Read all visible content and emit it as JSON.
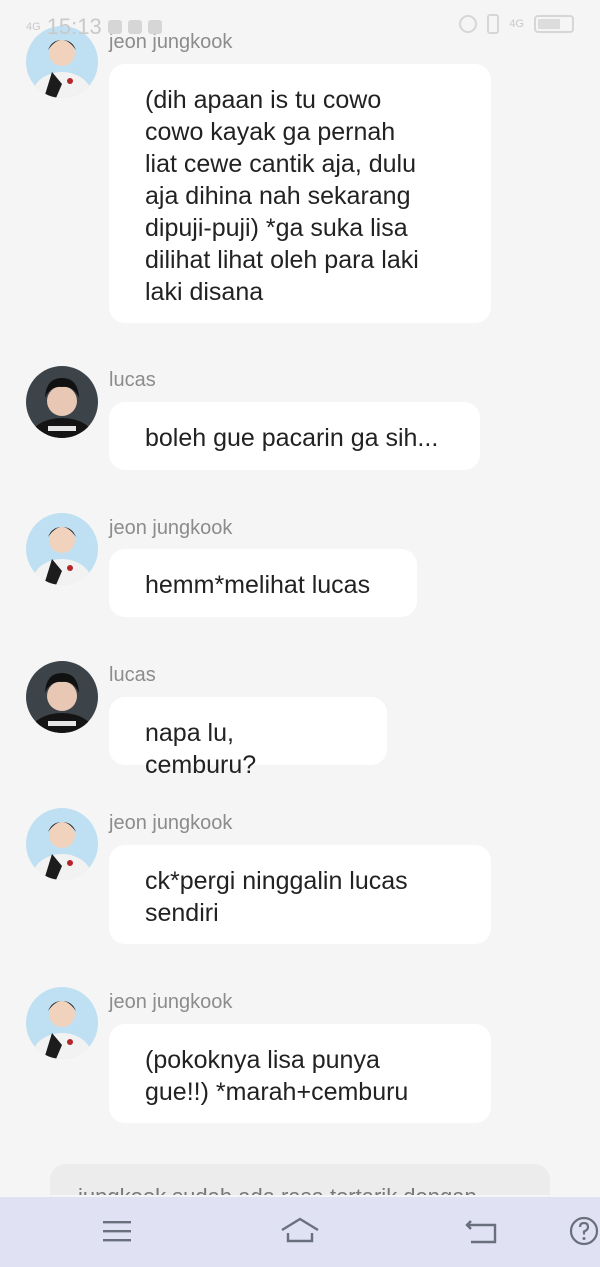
{
  "status_bar": {
    "time": "15:13",
    "network_left": "4G",
    "network_right": "4G"
  },
  "messages": [
    {
      "sender": "jeon jungkook",
      "avatar": "jungkook-avatar",
      "text": "(dih apaan is tu cowo\ncowo kayak ga pernah\nliat cewe cantik aja, dulu\naja dihina nah sekarang\ndipuji-puji) *ga suka lisa\ndilihat lihat oleh para laki\nlaki disana"
    },
    {
      "sender": "lucas",
      "avatar": "lucas-avatar",
      "text": "boleh gue pacarin ga sih..."
    },
    {
      "sender": "jeon jungkook",
      "avatar": "jungkook-avatar",
      "text": "hemm*melihat lucas"
    },
    {
      "sender": "lucas",
      "avatar": "lucas-avatar",
      "text": "napa lu, cemburu?"
    },
    {
      "sender": "jeon jungkook",
      "avatar": "jungkook-avatar",
      "text": "ck*pergi ninggalin lucas\nsendiri"
    },
    {
      "sender": "jeon jungkook",
      "avatar": "jungkook-avatar",
      "text": "(pokoknya lisa punya\ngue!!) *marah+cemburu"
    }
  ],
  "suggestion": {
    "text": "jungkook sudah ada rasa tertarik dengan"
  },
  "nav_bar": {
    "menu_icon": "menu-icon",
    "home_icon": "home-icon",
    "back_icon": "back-icon",
    "help_icon": "help-icon"
  },
  "colors": {
    "background": "#f5f5f5",
    "bubble": "#ffffff",
    "sender": "#8c8c8c",
    "nav_bar": "#e0e2f4"
  }
}
